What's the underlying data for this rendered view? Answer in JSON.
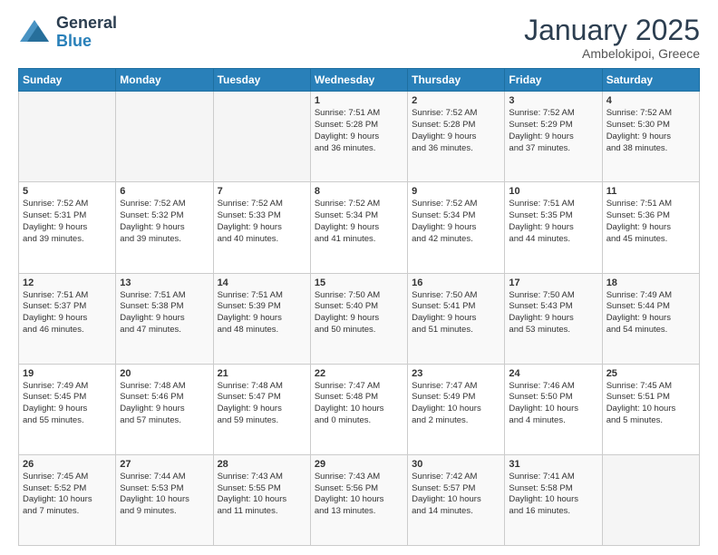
{
  "header": {
    "logo_general": "General",
    "logo_blue": "Blue",
    "month": "January 2025",
    "location": "Ambelokipoi, Greece"
  },
  "days_of_week": [
    "Sunday",
    "Monday",
    "Tuesday",
    "Wednesday",
    "Thursday",
    "Friday",
    "Saturday"
  ],
  "weeks": [
    [
      {
        "day": "",
        "detail": ""
      },
      {
        "day": "",
        "detail": ""
      },
      {
        "day": "",
        "detail": ""
      },
      {
        "day": "1",
        "detail": "Sunrise: 7:51 AM\nSunset: 5:28 PM\nDaylight: 9 hours\nand 36 minutes."
      },
      {
        "day": "2",
        "detail": "Sunrise: 7:52 AM\nSunset: 5:28 PM\nDaylight: 9 hours\nand 36 minutes."
      },
      {
        "day": "3",
        "detail": "Sunrise: 7:52 AM\nSunset: 5:29 PM\nDaylight: 9 hours\nand 37 minutes."
      },
      {
        "day": "4",
        "detail": "Sunrise: 7:52 AM\nSunset: 5:30 PM\nDaylight: 9 hours\nand 38 minutes."
      }
    ],
    [
      {
        "day": "5",
        "detail": "Sunrise: 7:52 AM\nSunset: 5:31 PM\nDaylight: 9 hours\nand 39 minutes."
      },
      {
        "day": "6",
        "detail": "Sunrise: 7:52 AM\nSunset: 5:32 PM\nDaylight: 9 hours\nand 39 minutes."
      },
      {
        "day": "7",
        "detail": "Sunrise: 7:52 AM\nSunset: 5:33 PM\nDaylight: 9 hours\nand 40 minutes."
      },
      {
        "day": "8",
        "detail": "Sunrise: 7:52 AM\nSunset: 5:34 PM\nDaylight: 9 hours\nand 41 minutes."
      },
      {
        "day": "9",
        "detail": "Sunrise: 7:52 AM\nSunset: 5:34 PM\nDaylight: 9 hours\nand 42 minutes."
      },
      {
        "day": "10",
        "detail": "Sunrise: 7:51 AM\nSunset: 5:35 PM\nDaylight: 9 hours\nand 44 minutes."
      },
      {
        "day": "11",
        "detail": "Sunrise: 7:51 AM\nSunset: 5:36 PM\nDaylight: 9 hours\nand 45 minutes."
      }
    ],
    [
      {
        "day": "12",
        "detail": "Sunrise: 7:51 AM\nSunset: 5:37 PM\nDaylight: 9 hours\nand 46 minutes."
      },
      {
        "day": "13",
        "detail": "Sunrise: 7:51 AM\nSunset: 5:38 PM\nDaylight: 9 hours\nand 47 minutes."
      },
      {
        "day": "14",
        "detail": "Sunrise: 7:51 AM\nSunset: 5:39 PM\nDaylight: 9 hours\nand 48 minutes."
      },
      {
        "day": "15",
        "detail": "Sunrise: 7:50 AM\nSunset: 5:40 PM\nDaylight: 9 hours\nand 50 minutes."
      },
      {
        "day": "16",
        "detail": "Sunrise: 7:50 AM\nSunset: 5:41 PM\nDaylight: 9 hours\nand 51 minutes."
      },
      {
        "day": "17",
        "detail": "Sunrise: 7:50 AM\nSunset: 5:43 PM\nDaylight: 9 hours\nand 53 minutes."
      },
      {
        "day": "18",
        "detail": "Sunrise: 7:49 AM\nSunset: 5:44 PM\nDaylight: 9 hours\nand 54 minutes."
      }
    ],
    [
      {
        "day": "19",
        "detail": "Sunrise: 7:49 AM\nSunset: 5:45 PM\nDaylight: 9 hours\nand 55 minutes."
      },
      {
        "day": "20",
        "detail": "Sunrise: 7:48 AM\nSunset: 5:46 PM\nDaylight: 9 hours\nand 57 minutes."
      },
      {
        "day": "21",
        "detail": "Sunrise: 7:48 AM\nSunset: 5:47 PM\nDaylight: 9 hours\nand 59 minutes."
      },
      {
        "day": "22",
        "detail": "Sunrise: 7:47 AM\nSunset: 5:48 PM\nDaylight: 10 hours\nand 0 minutes."
      },
      {
        "day": "23",
        "detail": "Sunrise: 7:47 AM\nSunset: 5:49 PM\nDaylight: 10 hours\nand 2 minutes."
      },
      {
        "day": "24",
        "detail": "Sunrise: 7:46 AM\nSunset: 5:50 PM\nDaylight: 10 hours\nand 4 minutes."
      },
      {
        "day": "25",
        "detail": "Sunrise: 7:45 AM\nSunset: 5:51 PM\nDaylight: 10 hours\nand 5 minutes."
      }
    ],
    [
      {
        "day": "26",
        "detail": "Sunrise: 7:45 AM\nSunset: 5:52 PM\nDaylight: 10 hours\nand 7 minutes."
      },
      {
        "day": "27",
        "detail": "Sunrise: 7:44 AM\nSunset: 5:53 PM\nDaylight: 10 hours\nand 9 minutes."
      },
      {
        "day": "28",
        "detail": "Sunrise: 7:43 AM\nSunset: 5:55 PM\nDaylight: 10 hours\nand 11 minutes."
      },
      {
        "day": "29",
        "detail": "Sunrise: 7:43 AM\nSunset: 5:56 PM\nDaylight: 10 hours\nand 13 minutes."
      },
      {
        "day": "30",
        "detail": "Sunrise: 7:42 AM\nSunset: 5:57 PM\nDaylight: 10 hours\nand 14 minutes."
      },
      {
        "day": "31",
        "detail": "Sunrise: 7:41 AM\nSunset: 5:58 PM\nDaylight: 10 hours\nand 16 minutes."
      },
      {
        "day": "",
        "detail": ""
      }
    ]
  ]
}
